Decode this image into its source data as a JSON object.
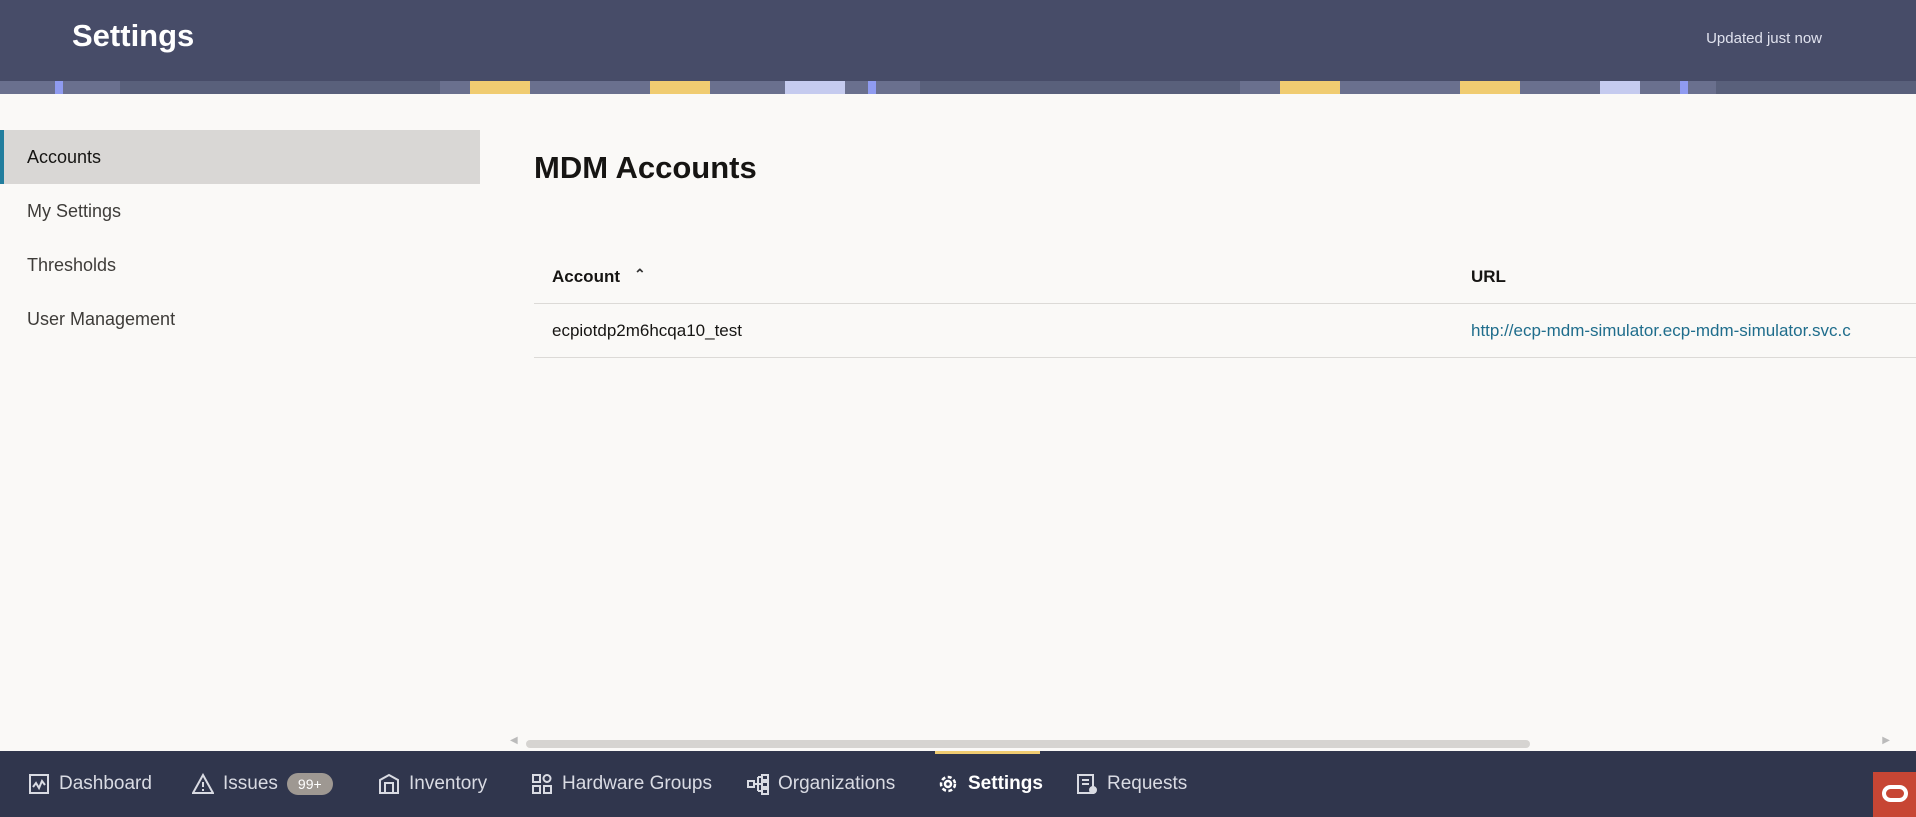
{
  "header": {
    "title": "Settings",
    "status": "Updated just now"
  },
  "sidebar": {
    "items": [
      {
        "label": "Accounts",
        "active": true
      },
      {
        "label": "My Settings"
      },
      {
        "label": "Thresholds"
      },
      {
        "label": "User Management"
      }
    ]
  },
  "main": {
    "title": "MDM Accounts",
    "table": {
      "columns": [
        "Account",
        "URL"
      ],
      "rows": [
        {
          "account": "ecpiotdp2m6hcqa10_test",
          "url": "http://ecp-mdm-simulator.ecp-mdm-simulator.svc.c"
        }
      ]
    }
  },
  "nav": {
    "items": [
      {
        "label": "Dashboard",
        "icon": "dashboard-icon"
      },
      {
        "label": "Issues",
        "icon": "warning-icon",
        "badge": "99+"
      },
      {
        "label": "Inventory",
        "icon": "warehouse-icon"
      },
      {
        "label": "Hardware Groups",
        "icon": "groups-icon"
      },
      {
        "label": "Organizations",
        "icon": "hierarchy-icon"
      },
      {
        "label": "Settings",
        "icon": "gear-icon",
        "active": true
      },
      {
        "label": "Requests",
        "icon": "requests-icon"
      }
    ]
  },
  "colors": {
    "header": "#474c68",
    "nav": "#30364d",
    "accent": "#227e9e",
    "active_indicator": "#f0cc71",
    "oracle": "#c74634"
  }
}
